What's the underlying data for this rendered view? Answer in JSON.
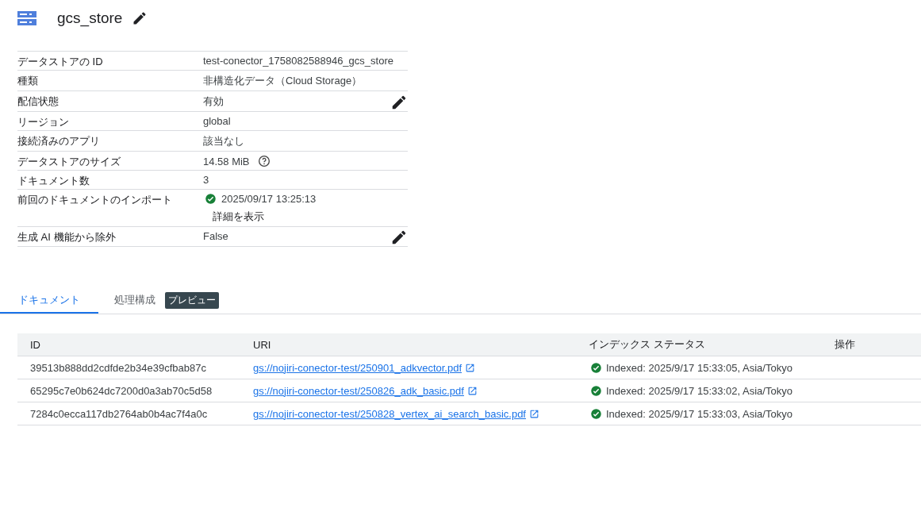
{
  "header": {
    "title": "gcs_store"
  },
  "details": [
    {
      "kind": "text",
      "label": "データストアの ID",
      "value": "test-conector_1758082588946_gcs_store",
      "editable": false
    },
    {
      "kind": "text",
      "label": "種類",
      "value": "非構造化データ（Cloud Storage）",
      "editable": false
    },
    {
      "kind": "text",
      "label": "配信状態",
      "value": "有効",
      "editable": true
    },
    {
      "kind": "text",
      "label": "リージョン",
      "value": "global",
      "editable": false
    },
    {
      "kind": "text",
      "label": "接続済みのアプリ",
      "value": "該当なし",
      "editable": false
    },
    {
      "kind": "help",
      "label": "データストアのサイズ",
      "value": "14.58 MiB",
      "editable": false
    },
    {
      "kind": "text",
      "label": "ドキュメント数",
      "value": "3",
      "editable": false
    },
    {
      "kind": "import",
      "label": "前回のドキュメントのインポート",
      "value": "2025/09/17 13:25:13",
      "link": "詳細を表示",
      "editable": false
    },
    {
      "kind": "text",
      "label": "生成 AI 機能から除外",
      "value": "False",
      "editable": true
    }
  ],
  "tabs": [
    {
      "label": "ドキュメント",
      "selected": true
    },
    {
      "label": "処理構成",
      "selected": false,
      "badge": "プレビュー"
    }
  ],
  "table": {
    "columns": [
      "ID",
      "URI",
      "インデックス ステータス",
      "操作"
    ],
    "rows": [
      {
        "id": "39513b888dd2cdfde2b34e39cfbab87c",
        "uri": "gs://nojiri-conector-test/250901_adkvector.pdf",
        "status": "Indexed: 2025/9/17 15:33:05, Asia/Tokyo"
      },
      {
        "id": "65295c7e0b624dc7200d0a3ab70c5d58",
        "uri": "gs://nojiri-conector-test/250826_adk_basic.pdf",
        "status": "Indexed: 2025/9/17 15:33:02, Asia/Tokyo"
      },
      {
        "id": "7284c0ecca117db2764ab0b4ac7f4a0c",
        "uri": "gs://nojiri-conector-test/250828_vertex_ai_search_basic.pdf",
        "status": "Indexed: 2025/9/17 15:33:03, Asia/Tokyo"
      }
    ]
  }
}
